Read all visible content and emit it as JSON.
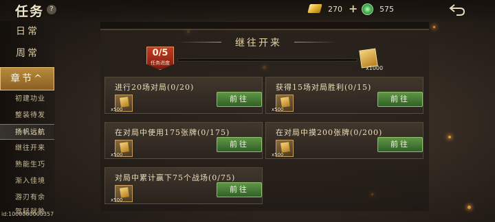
{
  "header": {
    "title": "任务",
    "help_symbol": "?",
    "gold_value": "270",
    "plus_symbol": "+",
    "jade_value": "575"
  },
  "sidebar": {
    "main_items": [
      "日常",
      "周常"
    ],
    "active_item": "章节",
    "active_arrow": "^",
    "sub_items": [
      "初建功业",
      "整装待发",
      "扬帆远航",
      "继往开来",
      "熟能生巧",
      "渐入佳境",
      "游刃有余",
      "驾轻就熟"
    ],
    "selected_sub_index": 2,
    "uid": "id:1000000000357"
  },
  "section": {
    "title": "继往开来",
    "progress_count": "0/5",
    "progress_label": "任务进度",
    "progress_fraction": 0,
    "big_reward_value": "x1000"
  },
  "tasks": [
    {
      "title": "进行20场对局(0/20)",
      "reward_value": "x500",
      "button": "前往"
    },
    {
      "title": "获得15场对局胜利(0/15)",
      "reward_value": "x500",
      "button": "前往"
    },
    {
      "title": "在对局中使用175张牌(0/175)",
      "reward_value": "x500",
      "button": "前往"
    },
    {
      "title": "在对局中摸200张牌(0/200)",
      "reward_value": "x500",
      "button": "前往"
    },
    {
      "title": "对局中累计赢下75个战场(0/75)",
      "reward_value": "x500",
      "button": "前往"
    }
  ],
  "colors": {
    "accent_gold": "#c29b4c",
    "button_green": "#4f8a3c",
    "badge_red": "#b32f1c"
  },
  "icons": [
    "help-icon",
    "gold-ingot-icon",
    "plus-icon",
    "jade-icon",
    "back-arrow-icon",
    "reward-card-icon"
  ]
}
